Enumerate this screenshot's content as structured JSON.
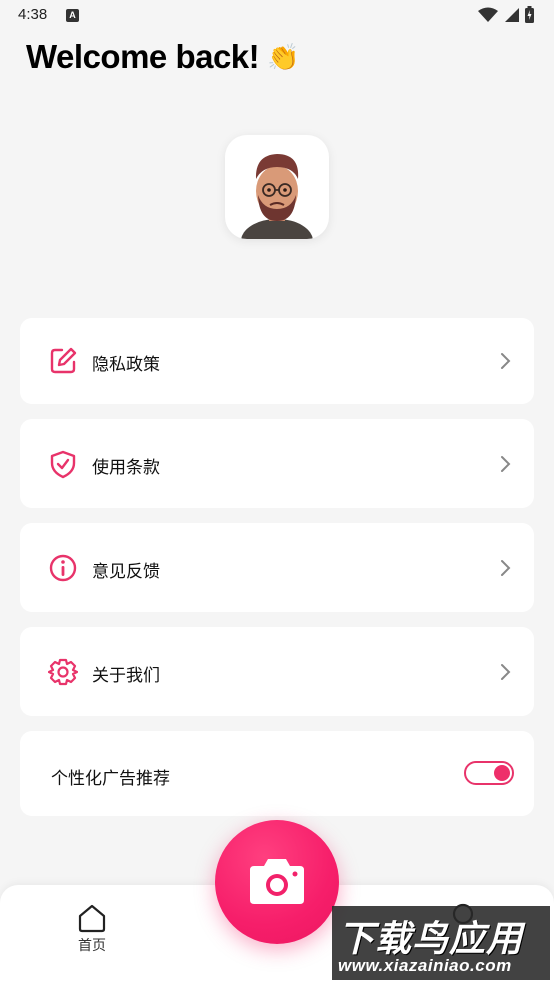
{
  "status_bar": {
    "time": "4:38",
    "notification_badge": "A"
  },
  "header": {
    "welcome_text": "Welcome back!",
    "emoji": "👏"
  },
  "menu": {
    "items": [
      {
        "label": "隐私政策",
        "icon": "edit-icon"
      },
      {
        "label": "使用条款",
        "icon": "shield-check-icon"
      },
      {
        "label": "意见反馈",
        "icon": "info-icon"
      },
      {
        "label": "关于我们",
        "icon": "gear-icon"
      }
    ],
    "ad_toggle": {
      "label": "个性化广告推荐",
      "enabled": true
    }
  },
  "bottom_nav": {
    "home_label": "首页"
  },
  "colors": {
    "accent": "#ee2f6a",
    "background": "#f5f5f5",
    "card": "#ffffff"
  },
  "watermark": {
    "main": "下载鸟应用",
    "url": "www.xiazainiao.com"
  }
}
